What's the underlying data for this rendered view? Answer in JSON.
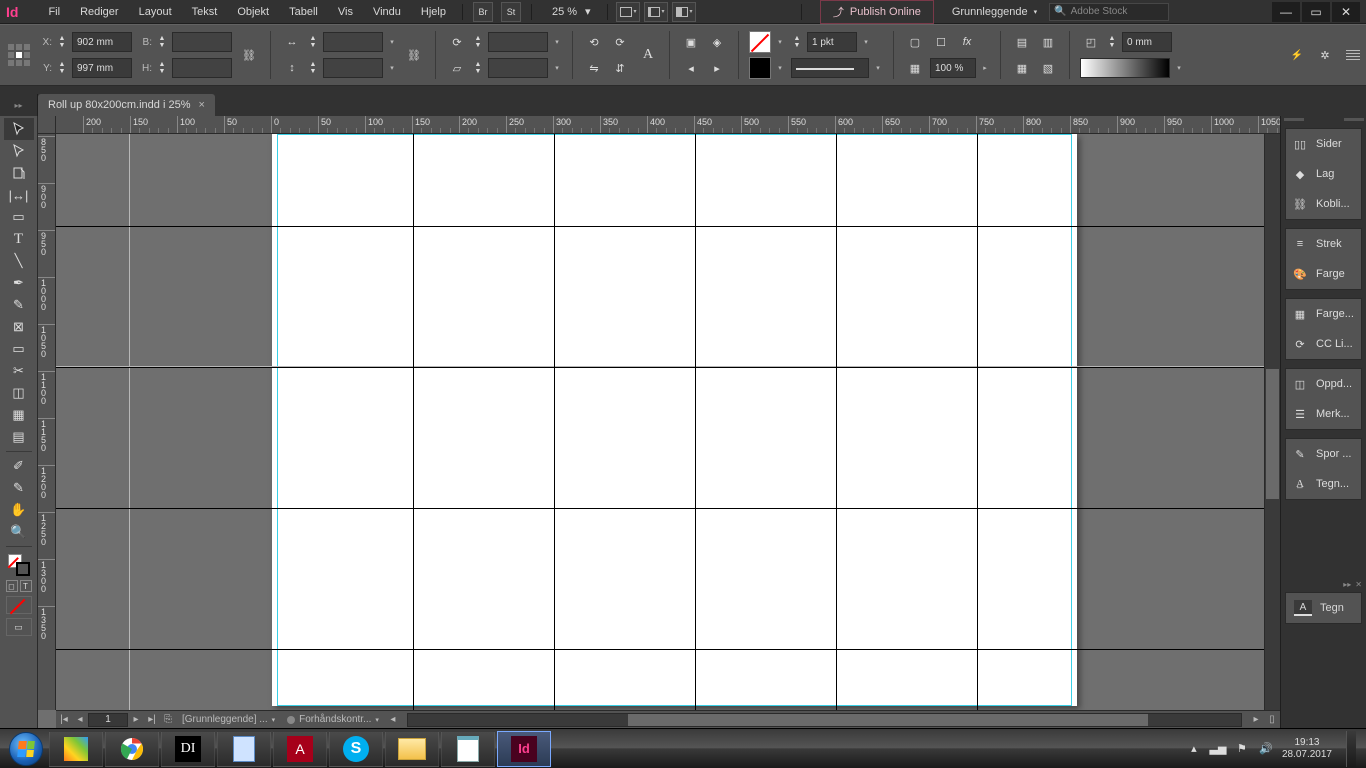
{
  "app_logo": "Id",
  "menus": [
    "Fil",
    "Rediger",
    "Layout",
    "Tekst",
    "Objekt",
    "Tabell",
    "Vis",
    "Vindu",
    "Hjelp"
  ],
  "top_icons": [
    "Br",
    "St"
  ],
  "zoom": "25 %",
  "publish_label": "Publish Online",
  "workspace": "Grunnleggende",
  "stock_placeholder": "Adobe Stock",
  "control": {
    "x_label": "X:",
    "y_label": "Y:",
    "x_value": "902 mm",
    "y_value": "997 mm",
    "w_label": "B:",
    "h_label": "H:",
    "w_value": "",
    "h_value": "",
    "stroke_weight": "1 pkt",
    "opacity": "100 %",
    "transform_ref": "0 mm"
  },
  "document_tab": "Roll up 80x200cm.indd i 25%",
  "ruler_h_labels": [
    "200",
    "150",
    "100",
    "50",
    "0",
    "50",
    "100",
    "150",
    "200",
    "250",
    "300",
    "350",
    "400",
    "450",
    "500",
    "550",
    "600",
    "650",
    "700",
    "750",
    "800",
    "850",
    "900",
    "950",
    "1000",
    "1050"
  ],
  "ruler_v_labels": [
    "850",
    "900",
    "950",
    "1000",
    "1050",
    "1100",
    "1150",
    "1200",
    "1250",
    "1300",
    "1350"
  ],
  "panels": {
    "group1": [
      "Sider",
      "Lag",
      "Kobli..."
    ],
    "group2": [
      "Strek",
      "Farge"
    ],
    "group3": [
      "Farge...",
      "CC Li..."
    ],
    "group4": [
      "Oppd...",
      "Merk..."
    ],
    "group5": [
      "Spor ...",
      "Tegn..."
    ],
    "tegn": "Tegn"
  },
  "status": {
    "page": "1",
    "combo1": "[Grunnleggende] ...",
    "combo2": "Forhåndskontr..."
  },
  "tray": {
    "time": "19:13",
    "date": "28.07.2017"
  }
}
